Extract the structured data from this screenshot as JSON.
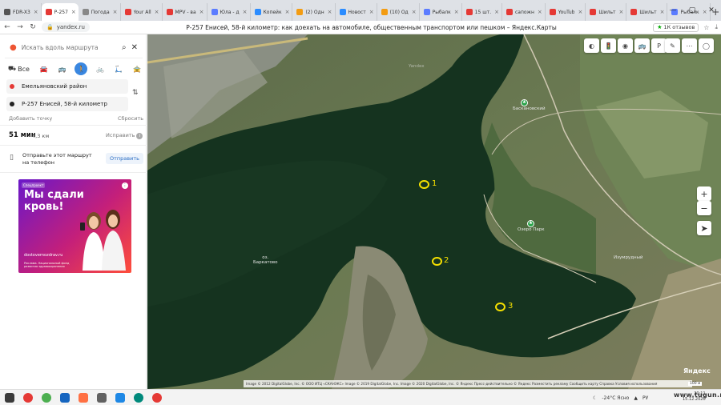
{
  "browser": {
    "tabs": [
      {
        "title": "FDR-X3",
        "color": "#555555"
      },
      {
        "title": "Р-257",
        "color": "#e53935",
        "active": true
      },
      {
        "title": "Погода",
        "color": "#888888"
      },
      {
        "title": "Your All",
        "color": "#e53935"
      },
      {
        "title": "MPV - ва",
        "color": "#e53935"
      },
      {
        "title": "Юла - д",
        "color": "#5b7cff"
      },
      {
        "title": "Копейк",
        "color": "#2b8cff"
      },
      {
        "title": "(2) Одн",
        "color": "#f39c12"
      },
      {
        "title": "Новост",
        "color": "#2b8cff"
      },
      {
        "title": "(10) Од",
        "color": "#f39c12"
      },
      {
        "title": "Рыбалк",
        "color": "#5b7cff"
      },
      {
        "title": "15 шт.",
        "color": "#e53935"
      },
      {
        "title": "сапожн",
        "color": "#e53935"
      },
      {
        "title": "YouTub",
        "color": "#e53935"
      },
      {
        "title": "Шильт",
        "color": "#e53935"
      },
      {
        "title": "Шильт",
        "color": "#e53935"
      },
      {
        "title": "Рыбалк",
        "color": "#5b7cff"
      }
    ],
    "url": "yandex.ru",
    "page_title": "Р-257 Енисей, 58-й километр: как доехать на автомобиле, общественным транспортом или пешком – Яндекс.Карты",
    "reviews_label": "1К отзывов"
  },
  "sidebar": {
    "search_placeholder": "Искать вдоль маршрута",
    "modes": [
      {
        "name": "all",
        "label": "Все",
        "icon": "⛟"
      },
      {
        "name": "car",
        "icon": "🚘"
      },
      {
        "name": "bus",
        "icon": "🚌"
      },
      {
        "name": "walk",
        "icon": "🚶",
        "active": true
      },
      {
        "name": "bike",
        "icon": "🚲"
      },
      {
        "name": "scooter",
        "icon": "🛴"
      },
      {
        "name": "taxi",
        "icon": "🚖"
      }
    ],
    "point_a": "Емельяновский район",
    "point_b": "Р-257 Енисей, 58-й километр",
    "add_point": "Добавить точку",
    "reset": "Сбросить",
    "route_time": "51 мин",
    "route_distance": "4,3 км",
    "fix_label": "Исправить",
    "send_text": "Отправьте этот маршрут на телефон",
    "send_button": "Отправить",
    "ad": {
      "label": "Спецпроект",
      "headline": "Мы сдали кровь!",
      "site": "dostovernozdrav.ru",
      "fine": "Реклама. Национальный фонд развития здравоохранения"
    }
  },
  "map": {
    "markers": [
      {
        "label": "1"
      },
      {
        "label": "2"
      },
      {
        "label": "3"
      }
    ],
    "labels": {
      "lake": "оз.\nБаркатово",
      "zapoved": "Баскановский",
      "park": "Озеро Парк",
      "izumrud": "Изумрудный",
      "yandex_wm": "Yandex"
    },
    "copyright": "Image © 2012 DigitalGlobe, Inc. © ООО ИТЦ «СКАНЭКС» Image © 2019 DigitalGlobe, Inc. Image © 2020 DigitalGlobe, Inc. © Яндекс   Пресс-действительно   © Яндекс  Разместить рекламу  Сообщить карту  Справка  Условия использования",
    "logo": "Яндекс",
    "scale": "100 м"
  },
  "taskbar": {
    "weather": "-24°C  Ясно",
    "lang": "РУ",
    "time": "20:11",
    "date": "15.12.2020",
    "watermark": "www.tugun.ru"
  }
}
